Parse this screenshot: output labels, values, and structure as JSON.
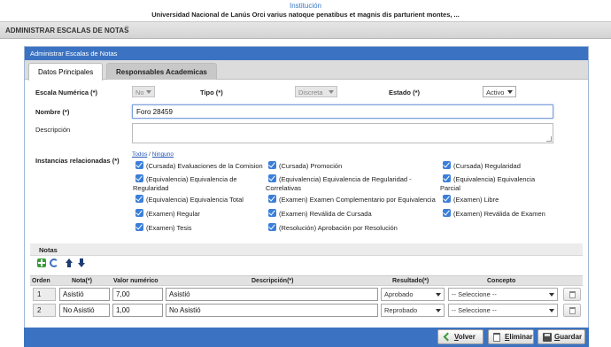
{
  "header": {
    "institution_label": "Institución",
    "institution_name": "Universidad Nacional de Lanús Orci varius natoque penatibus et magnis dis parturient montes, ..."
  },
  "page": {
    "title": "ADMINISTRAR ESCALAS DE NOTAS",
    "help_icon": "?"
  },
  "panel": {
    "title": "Administrar Escalas de Notas",
    "tabs": [
      {
        "label": "Datos Principales",
        "active": true
      },
      {
        "label": "Responsables Academicas",
        "active": false
      }
    ]
  },
  "form": {
    "escala_label": "Escala Numérica (*)",
    "escala_value": "No",
    "tipo_label": "Tipo (*)",
    "tipo_value": "Discreta",
    "estado_label": "Estado (*)",
    "estado_value": "Activo",
    "nombre_label": "Nombre (*)",
    "nombre_value": "Foro 28459",
    "descripcion_label": "Descripción",
    "instancias_label": "Instancias relacionadas (*)",
    "todos": "Todos",
    "ninguno": "Ninguno",
    "link_sep": "/"
  },
  "instancias": [
    {
      "line1": "(Cursada) Evaluaciones de la Comision",
      "line2": ""
    },
    {
      "line1": "(Cursada) Promoción",
      "line2": ""
    },
    {
      "line1": "(Cursada) Regularidad",
      "line2": ""
    },
    {
      "line1": "(Equivalencia) Equivalencia de",
      "line2": "Regularidad"
    },
    {
      "line1": "(Equivalencia) Equivalencia de Regularidad -",
      "line2": "Correlativas"
    },
    {
      "line1": "(Equivalencia) Equivalencia",
      "line2": "Parcial"
    },
    {
      "line1": "(Equivalencia) Equivalencia Total",
      "line2": ""
    },
    {
      "line1": "(Examen) Examen Complementario por Equivalencia",
      "line2": ""
    },
    {
      "line1": "(Examen) Libre",
      "line2": ""
    },
    {
      "line1": "(Examen) Regular",
      "line2": ""
    },
    {
      "line1": "(Examen) Reválida de Cursada",
      "line2": ""
    },
    {
      "line1": "(Examen) Reválida de Examen",
      "line2": ""
    },
    {
      "line1": "(Examen) Tesis",
      "line2": ""
    },
    {
      "line1": "(Resolución) Aprobación por Resolución",
      "line2": ""
    }
  ],
  "notas": {
    "title": "Notas",
    "columns": [
      "Orden",
      "Nota(*)",
      "Valor numérico",
      "Descripción(*)",
      "Resultado(*)",
      "Concepto"
    ],
    "rows": [
      {
        "orden": "1",
        "nota": "Asistió",
        "valor": "7,00",
        "descripcion": "Asistió",
        "resultado": "Aprobado",
        "concepto": "-- Seleccione --"
      },
      {
        "orden": "2",
        "nota": "No Asistió",
        "valor": "1,00",
        "descripcion": "No Asistió",
        "resultado": "Reprobado",
        "concepto": "-- Seleccione --"
      }
    ]
  },
  "footer": {
    "volver_u": "V",
    "volver_rest": "olver",
    "eliminar_u": "E",
    "eliminar_rest": "liminar",
    "guardar_u": "G",
    "guardar_rest": "uardar"
  },
  "colors": {
    "primary_blue": "#3b73c2",
    "checkbox_blue": "#3b7fd8"
  }
}
